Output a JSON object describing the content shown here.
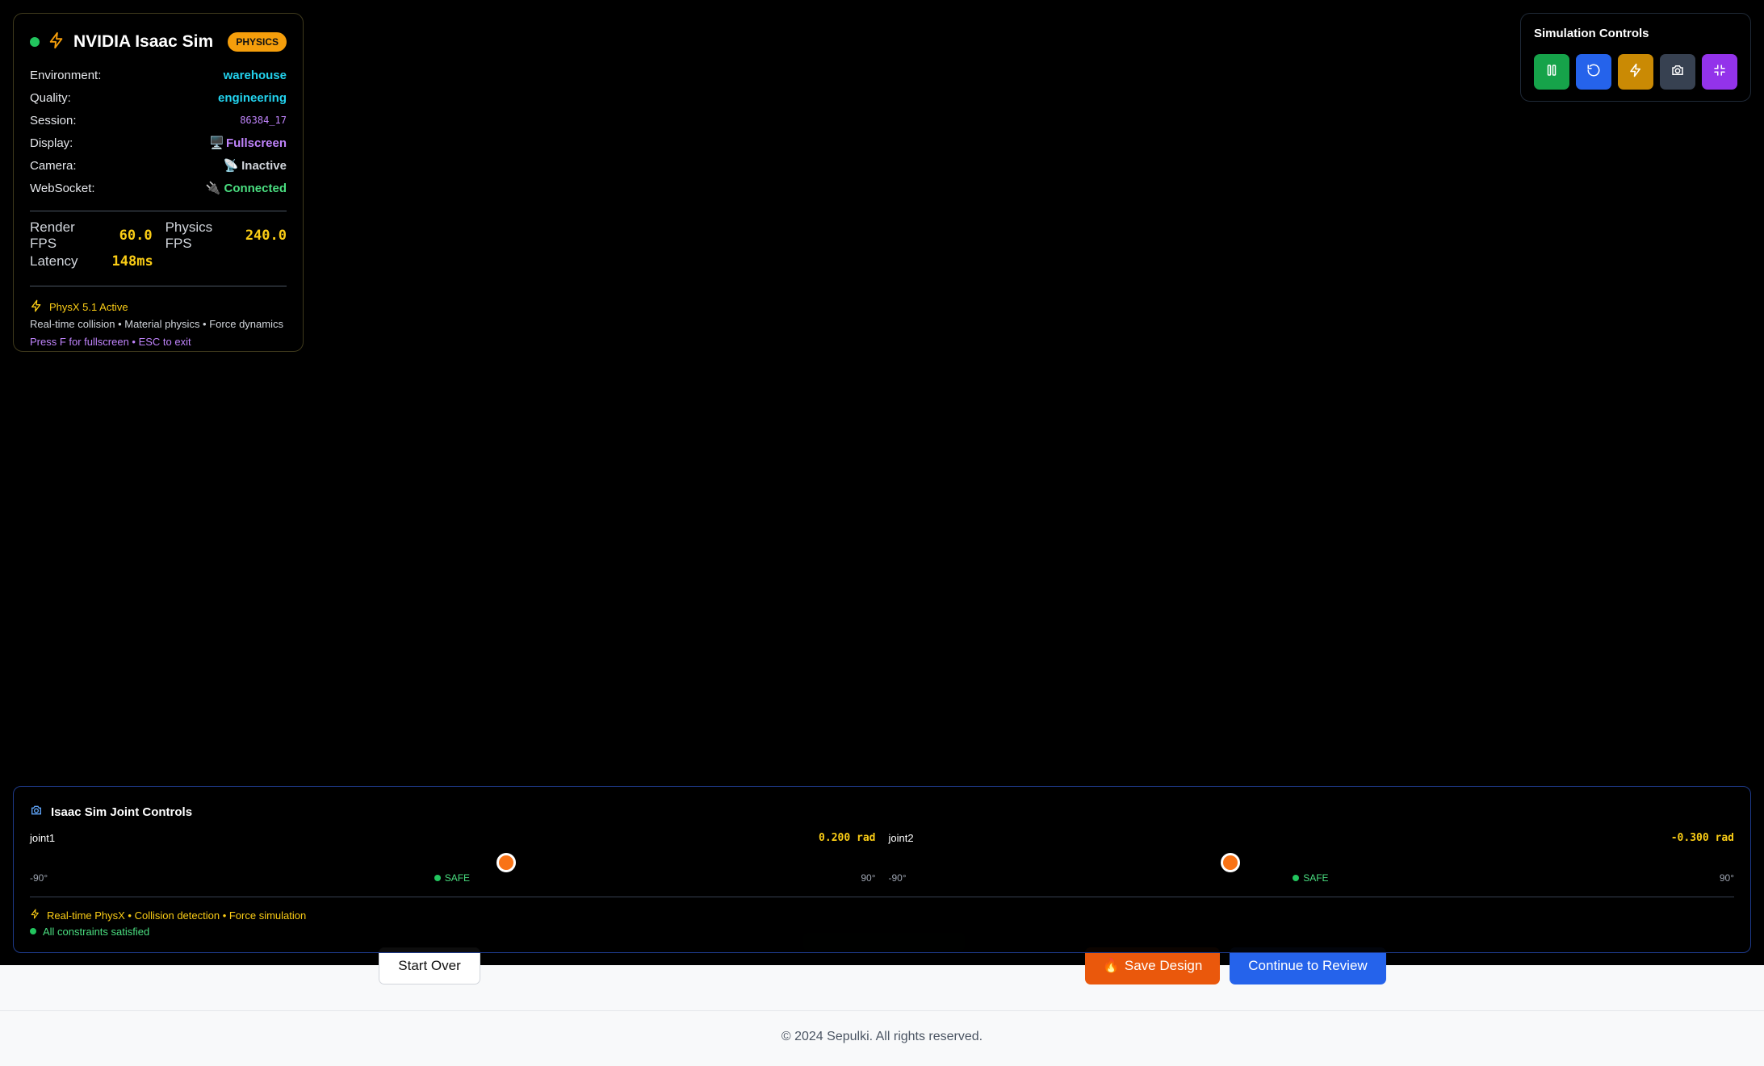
{
  "status": {
    "title": "NVIDIA Isaac Sim",
    "badge": "PHYSICS",
    "rows": [
      {
        "key": "Environment:",
        "value": "warehouse"
      },
      {
        "key": "Quality:",
        "value": "engineering"
      },
      {
        "key": "Session:",
        "value": "86384_17"
      },
      {
        "key": "Display:",
        "value": "Fullscreen"
      },
      {
        "key": "Camera:",
        "value": "Inactive"
      },
      {
        "key": "WebSocket:",
        "value": "Connected"
      }
    ],
    "metrics": {
      "render_fps_label": "Render FPS",
      "render_fps": "60.0",
      "physics_fps_label": "Physics FPS",
      "physics_fps": "240.0",
      "latency_label": "Latency",
      "latency": "148ms"
    },
    "physx_line": "PhysX 5.1 Active",
    "physx_desc": "Real-time collision • Material physics • Force dynamics",
    "hint": "Press F for fullscreen • ESC to exit"
  },
  "sim_controls": {
    "title": "Simulation Controls",
    "buttons": [
      {
        "icon": "pause-icon",
        "color": "#16a34a"
      },
      {
        "icon": "reset-icon",
        "color": "#2563eb"
      },
      {
        "icon": "lightning-icon",
        "color": "#ca8a04"
      },
      {
        "icon": "camera-icon",
        "color": "#374151"
      },
      {
        "icon": "exit-fullscreen-icon",
        "color": "#9333ea"
      }
    ]
  },
  "joint_panel": {
    "title": "Isaac Sim Joint Controls",
    "joints": [
      {
        "name": "joint1",
        "value": "0.200 rad",
        "min": "-90°",
        "max": "90°",
        "status": "SAFE",
        "level": 0.5636
      },
      {
        "name": "joint2",
        "value": "-0.300 rad",
        "min": "-90°",
        "max": "90°",
        "status": "SAFE",
        "level": 0.4045
      }
    ],
    "footer_line": "Real-time PhysX • Collision detection • Force simulation",
    "constraint_status": "All constraints satisfied"
  },
  "page": {
    "start_over": "Start Over",
    "save_design": "Save Design",
    "continue": "Continue to Review",
    "footer": "© 2024 Sepulki. All rights reserved."
  }
}
